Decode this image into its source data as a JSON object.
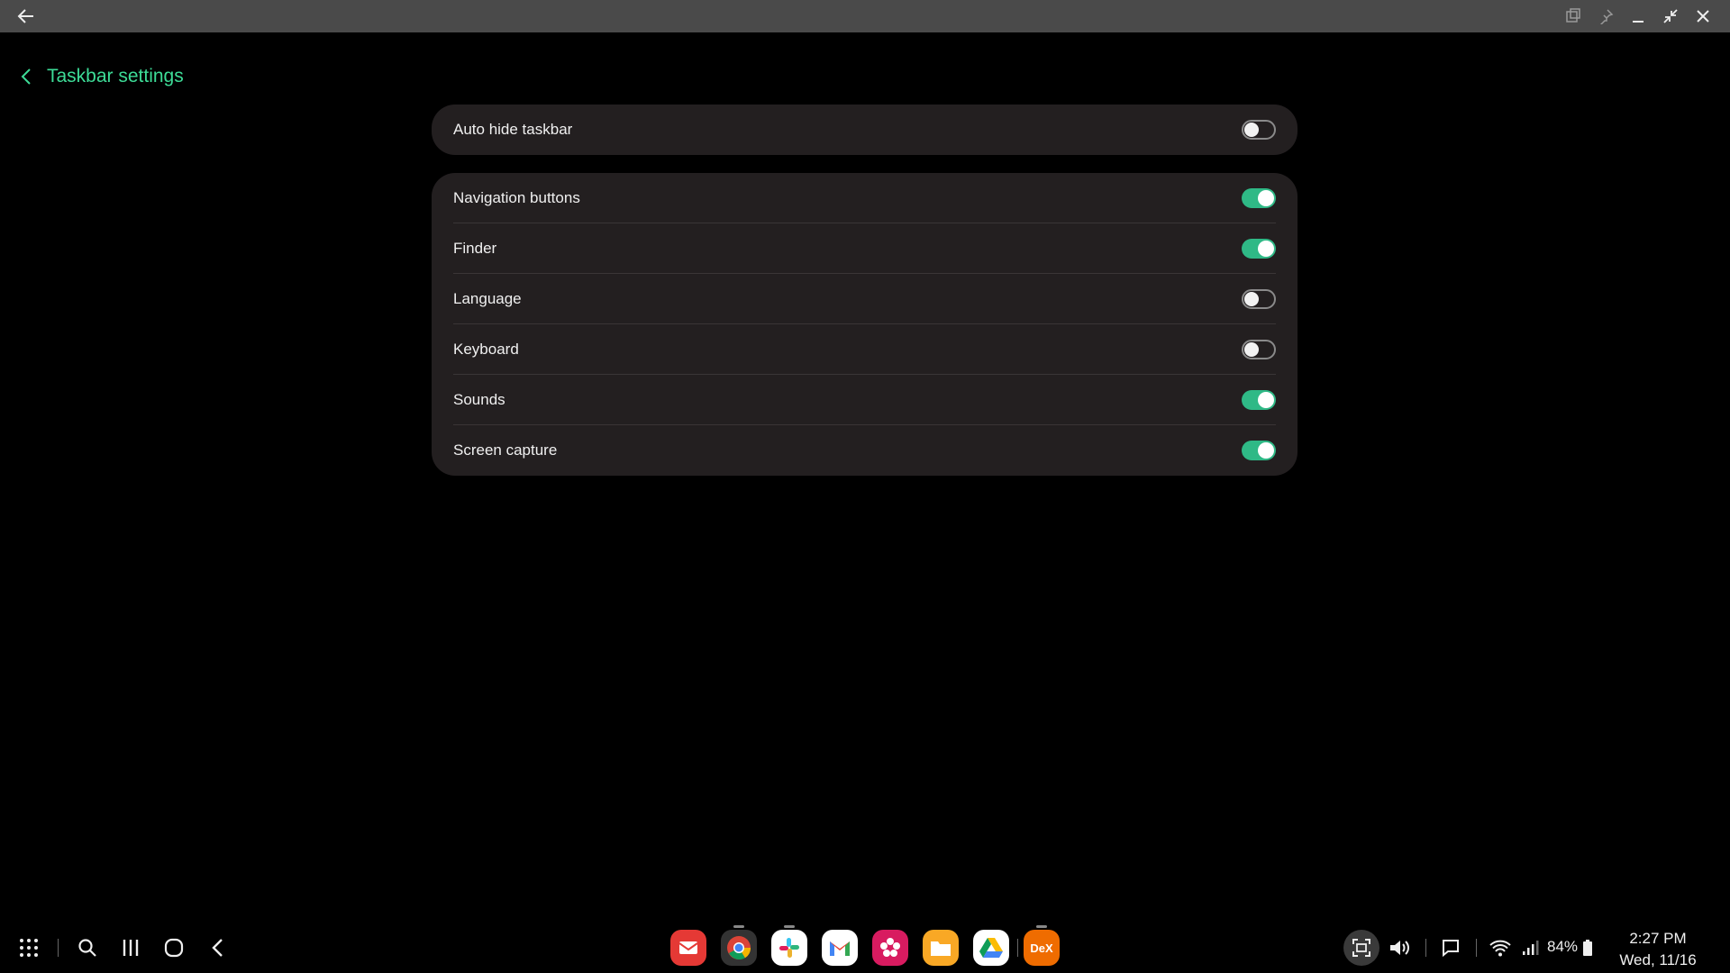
{
  "header": {
    "title": "Taskbar settings"
  },
  "auto_hide": {
    "label": "Auto hide taskbar",
    "enabled": false
  },
  "items": [
    {
      "label": "Navigation buttons",
      "enabled": true
    },
    {
      "label": "Finder",
      "enabled": true
    },
    {
      "label": "Language",
      "enabled": false
    },
    {
      "label": "Keyboard",
      "enabled": false
    },
    {
      "label": "Sounds",
      "enabled": true
    },
    {
      "label": "Screen capture",
      "enabled": true
    }
  ],
  "taskbar": {
    "apps": [
      {
        "name": "email-app-icon",
        "color": "#e53935"
      },
      {
        "name": "chrome-app-icon",
        "color": "#333333"
      },
      {
        "name": "slack-app-icon",
        "color": "#ffffff"
      },
      {
        "name": "gmail-app-icon",
        "color": "#ffffff"
      },
      {
        "name": "gallery-app-icon",
        "color": "#d81b60"
      },
      {
        "name": "files-app-icon",
        "color": "#f9a825"
      },
      {
        "name": "drive-app-icon",
        "color": "#ffffff"
      },
      {
        "name": "dex-app-icon",
        "color": "#ef6c00",
        "label": "DeX"
      }
    ],
    "battery": "84%",
    "time": "2:27 PM",
    "date": "Wed, 11/16"
  },
  "accent_color": "#3ddc97",
  "toggle_on_color": "#2fb986"
}
